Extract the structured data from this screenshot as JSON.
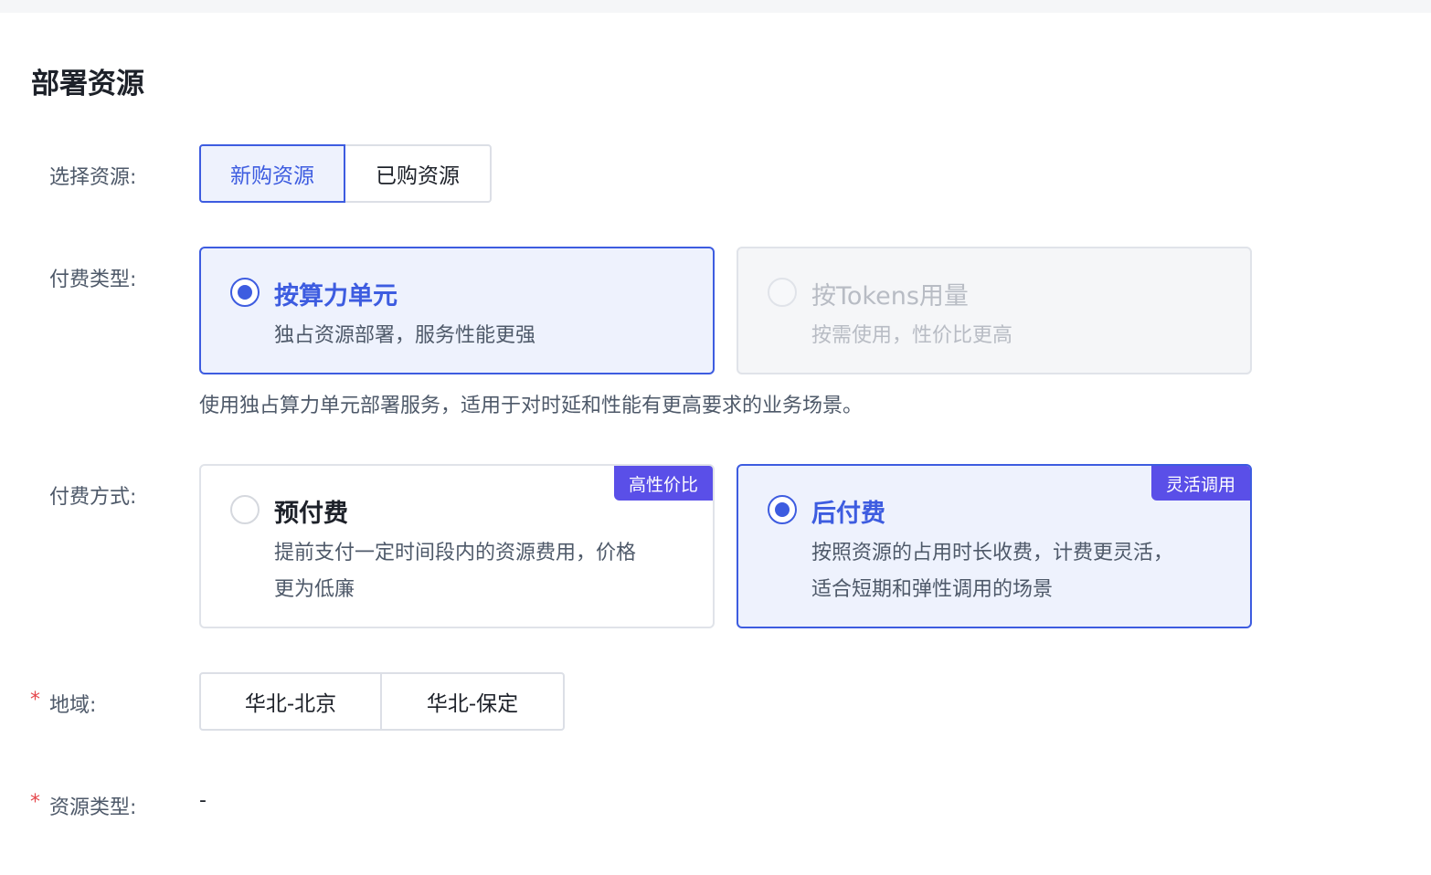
{
  "section_title": "部署资源",
  "select_resource": {
    "label": "选择资源:",
    "options": [
      "新购资源",
      "已购资源"
    ],
    "selected": "新购资源"
  },
  "billing_type": {
    "label": "付费类型:",
    "options": [
      {
        "title": "按算力单元",
        "desc": "独占资源部署，服务性能更强",
        "state": "selected"
      },
      {
        "title": "按Tokens用量",
        "desc": "按需使用，性价比更高",
        "state": "disabled"
      }
    ],
    "hint": "使用独占算力单元部署服务，适用于对时延和性能有更高要求的业务场景。"
  },
  "billing_method": {
    "label": "付费方式:",
    "options": [
      {
        "title": "预付费",
        "desc_line1": "提前支付一定时间段内的资源费用，价格",
        "desc_line2": "更为低廉",
        "badge": "高性价比",
        "state": "unselected"
      },
      {
        "title": "后付费",
        "desc_line1": "按照资源的占用时长收费，计费更灵活，",
        "desc_line2": "适合短期和弹性调用的场景",
        "badge": "灵活调用",
        "state": "selected"
      }
    ]
  },
  "region": {
    "required_mark": "*",
    "label": "地域:",
    "options": [
      "华北-北京",
      "华北-保定"
    ]
  },
  "resource_type": {
    "required_mark": "*",
    "label": "资源类型:",
    "value": "-"
  },
  "colors": {
    "accent": "#3d5ce0",
    "accent_bg": "#eef2fd",
    "badge": "#5a4fe8",
    "required": "#e5484d"
  }
}
